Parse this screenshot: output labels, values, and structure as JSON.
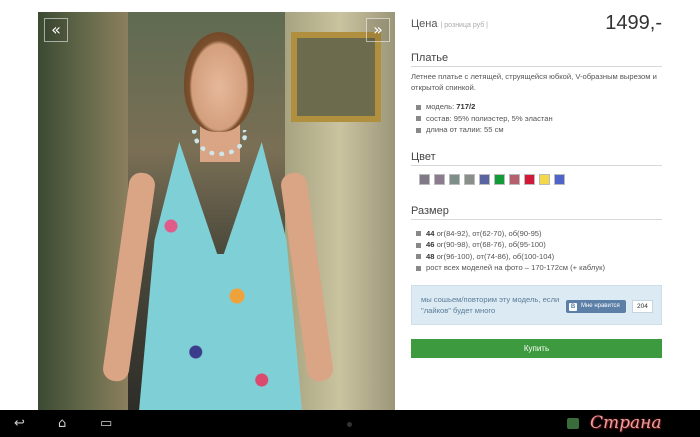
{
  "gallery": {
    "prev_icon": "double-chevron-left-icon",
    "prev_glyph": "«",
    "next_icon": "double-chevron-right-icon",
    "next_glyph": "»"
  },
  "price": {
    "label": "Цена",
    "sublabel": "| розница руб |",
    "value": "1499,-"
  },
  "product": {
    "title": "Платье",
    "description": "Летнее платье с летящей, струящейся юбкой, V-образным вырезом и открытой спинкой.",
    "props": [
      {
        "label": "модель: ",
        "value": "717/2"
      },
      {
        "label": "состав: 95% полиэстер, 5% эластан",
        "value": ""
      },
      {
        "label": "длина от талии: 55 см",
        "value": ""
      }
    ]
  },
  "colors": {
    "title": "Цвет",
    "swatches": [
      "#7f7a86",
      "#8c7b8f",
      "#7e8e88",
      "#8a8f8b",
      "#5a64a0",
      "#139b3a",
      "#b6606e",
      "#d11a38",
      "#f1d94a",
      "#4f63c9"
    ]
  },
  "sizes": {
    "title": "Размер",
    "items": [
      {
        "size": "44",
        "text": " ог(84-92), от(62-70), об(90-95)"
      },
      {
        "size": "46",
        "text": " ог(90-98), от(68-76), об(95-100)"
      },
      {
        "size": "48",
        "text": " ог(96-100), от(74-86), об(100-104)"
      },
      {
        "size": "",
        "text": "рост всех моделей на фото – 170-172см (+ каблук)"
      }
    ]
  },
  "promo": {
    "text": "мы сошьем/повторим эту модель, если \"лайков\" будет много",
    "like_label": "Мне нравится",
    "vk_glyph": "В",
    "like_count": "204"
  },
  "buy": {
    "label": "Купить"
  },
  "sysbar": {
    "back_glyph": "↩",
    "home_glyph": "⌂",
    "recent_glyph": "▭",
    "watermark": "Страна Мам"
  }
}
